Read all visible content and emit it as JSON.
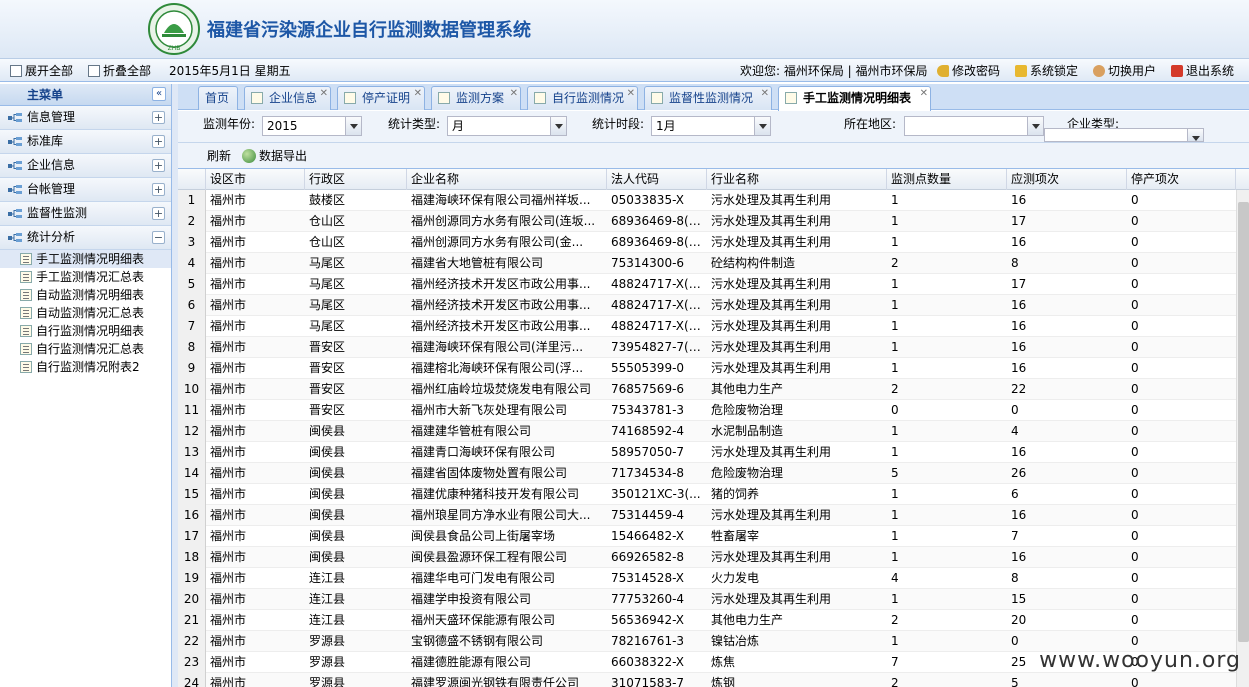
{
  "app": {
    "title": "福建省污染源企业自行监测数据管理系统"
  },
  "toolbar": {
    "expand_all": "展开全部",
    "collapse_all": "折叠全部",
    "date": "2015年5月1日 星期五",
    "welcome": "欢迎您: 福州环保局 | 福州市环保局",
    "change_password": "修改密码",
    "lock": "系统锁定",
    "switch_user": "切换用户",
    "logout": "退出系统"
  },
  "sidebar": {
    "title": "主菜单",
    "groups": [
      {
        "label": "信息管理",
        "state": "+"
      },
      {
        "label": "标准库",
        "state": "+"
      },
      {
        "label": "企业信息",
        "state": "+"
      },
      {
        "label": "台帐管理",
        "state": "+"
      },
      {
        "label": "监督性监测",
        "state": "+"
      },
      {
        "label": "统计分析",
        "state": "−"
      }
    ],
    "items": [
      "手工监测情况明细表",
      "手工监测情况汇总表",
      "自动监测情况明细表",
      "自动监测情况汇总表",
      "自行监测情况明细表",
      "自行监测情况汇总表",
      "自行监测情况附表2"
    ]
  },
  "tabs": [
    "首页",
    "企业信息",
    "停产证明",
    "监测方案",
    "自行监测情况",
    "监督性监测情况",
    "手工监测情况明细表"
  ],
  "filters": {
    "year_label": "监测年份:",
    "year_value": "2015",
    "stat_type_label": "统计类型:",
    "stat_type_value": "月",
    "period_label": "统计时段:",
    "period_value": "1月",
    "region_label": "所在地区:",
    "region_value": "",
    "ent_type_label": "企业类型:",
    "ent_type_value": ""
  },
  "actions": {
    "refresh": "刷新",
    "export": "数据导出"
  },
  "grid": {
    "columns": [
      "设区市",
      "行政区",
      "企业名称",
      "法人代码",
      "行业名称",
      "监测点数量",
      "应测项次",
      "停产项次"
    ],
    "rows": [
      [
        "1",
        "福州市",
        "鼓楼区",
        "福建海峡环保有限公司福州祥坂...",
        "05033835-X",
        "污水处理及其再生利用",
        "1",
        "16",
        "0"
      ],
      [
        "2",
        "福州市",
        "仓山区",
        "福州创源同方水务有限公司(连坂...",
        "68936469-8(01)",
        "污水处理及其再生利用",
        "1",
        "17",
        "0"
      ],
      [
        "3",
        "福州市",
        "仓山区",
        "福州创源同方水务有限公司(金...",
        "68936469-8(00)",
        "污水处理及其再生利用",
        "1",
        "16",
        "0"
      ],
      [
        "4",
        "福州市",
        "马尾区",
        "福建省大地管桩有限公司",
        "75314300-6",
        "砼结构构件制造",
        "2",
        "8",
        "0"
      ],
      [
        "5",
        "福州市",
        "马尾区",
        "福州经济技术开发区市政公用事...",
        "48824717-X(02)",
        "污水处理及其再生利用",
        "1",
        "17",
        "0"
      ],
      [
        "6",
        "福州市",
        "马尾区",
        "福州经济技术开发区市政公用事...",
        "48824717-X(00)",
        "污水处理及其再生利用",
        "1",
        "16",
        "0"
      ],
      [
        "7",
        "福州市",
        "马尾区",
        "福州经济技术开发区市政公用事...",
        "48824717-X(01)",
        "污水处理及其再生利用",
        "1",
        "16",
        "0"
      ],
      [
        "8",
        "福州市",
        "晋安区",
        "福建海峡环保有限公司(洋里污...",
        "73954827-7(00)",
        "污水处理及其再生利用",
        "1",
        "16",
        "0"
      ],
      [
        "9",
        "福州市",
        "晋安区",
        "福建榕北海峡环保有限公司(浮...",
        "55505399-0",
        "污水处理及其再生利用",
        "1",
        "16",
        "0"
      ],
      [
        "10",
        "福州市",
        "晋安区",
        "福州红庙岭垃圾焚烧发电有限公司",
        "76857569-6",
        "其他电力生产",
        "2",
        "22",
        "0"
      ],
      [
        "11",
        "福州市",
        "晋安区",
        "福州市大新飞灰处理有限公司",
        "75343781-3",
        "危险废物治理",
        "0",
        "0",
        "0"
      ],
      [
        "12",
        "福州市",
        "闽侯县",
        "福建建华管桩有限公司",
        "74168592-4",
        "水泥制品制造",
        "1",
        "4",
        "0"
      ],
      [
        "13",
        "福州市",
        "闽侯县",
        "福建青口海峡环保有限公司",
        "58957050-7",
        "污水处理及其再生利用",
        "1",
        "16",
        "0"
      ],
      [
        "14",
        "福州市",
        "闽侯县",
        "福建省固体废物处置有限公司",
        "71734534-8",
        "危险废物治理",
        "5",
        "26",
        "0"
      ],
      [
        "15",
        "福州市",
        "闽侯县",
        "福建优康种猪科技开发有限公司",
        "350121XC-3(...",
        "猪的饲养",
        "1",
        "6",
        "0"
      ],
      [
        "16",
        "福州市",
        "闽侯县",
        "福州琅星同方净水业有限公司大...",
        "75314459-4",
        "污水处理及其再生利用",
        "1",
        "16",
        "0"
      ],
      [
        "17",
        "福州市",
        "闽侯县",
        "闽侯县食品公司上街屠宰场",
        "15466482-X",
        "牲畜屠宰",
        "1",
        "7",
        "0"
      ],
      [
        "18",
        "福州市",
        "闽侯县",
        "闽侯县盈源环保工程有限公司",
        "66926582-8",
        "污水处理及其再生利用",
        "1",
        "16",
        "0"
      ],
      [
        "19",
        "福州市",
        "连江县",
        "福建华电可门发电有限公司",
        "75314528-X",
        "火力发电",
        "4",
        "8",
        "0"
      ],
      [
        "20",
        "福州市",
        "连江县",
        "福建学申投资有限公司",
        "77753260-4",
        "污水处理及其再生利用",
        "1",
        "15",
        "0"
      ],
      [
        "21",
        "福州市",
        "连江县",
        "福州天盛环保能源有限公司",
        "56536942-X",
        "其他电力生产",
        "2",
        "20",
        "0"
      ],
      [
        "22",
        "福州市",
        "罗源县",
        "宝钢德盛不锈钢有限公司",
        "78216761-3",
        "镍钴冶炼",
        "1",
        "0",
        "0"
      ],
      [
        "23",
        "福州市",
        "罗源县",
        "福建德胜能源有限公司",
        "66038322-X",
        "炼焦",
        "7",
        "25",
        "0"
      ],
      [
        "24",
        "福州市",
        "罗源县",
        "福建罗源闽光钢铁有限责任公司",
        "31071583-7",
        "炼钢",
        "2",
        "5",
        "0"
      ]
    ]
  },
  "watermark": "www.wooyun.org",
  "colors": {
    "title": "#1d57a6",
    "header_bg": "#dde8f5",
    "border": "#99bbe8"
  }
}
